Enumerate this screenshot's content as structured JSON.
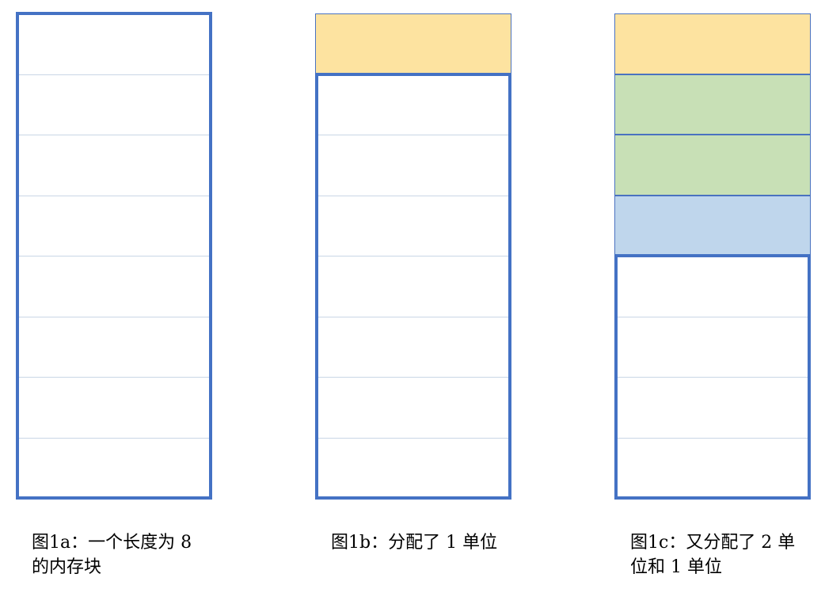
{
  "colors": {
    "outline": "#4472c4",
    "divider": "#c9d6e6",
    "free": "#ffffff",
    "yellow": "#fde3a0",
    "green": "#c8e0b6",
    "blue": "#bfd6ec"
  },
  "diagrams": [
    {
      "caption": "图1a：一个长度为 8 的内存块",
      "blocks": [
        "free",
        "free",
        "free",
        "free",
        "free",
        "free",
        "free",
        "free"
      ],
      "allocated_units": 0,
      "free_units": 8
    },
    {
      "caption": "图1b：分配了 1 单位",
      "blocks": [
        "yellow",
        "free",
        "free",
        "free",
        "free",
        "free",
        "free",
        "free"
      ],
      "allocated_units": 1,
      "free_units": 7
    },
    {
      "caption": "图1c：又分配了 2 单位和 1 单位",
      "blocks": [
        "yellow",
        "green",
        "green",
        "blue",
        "free",
        "free",
        "free",
        "free"
      ],
      "allocated_units": 4,
      "free_units": 4
    }
  ]
}
